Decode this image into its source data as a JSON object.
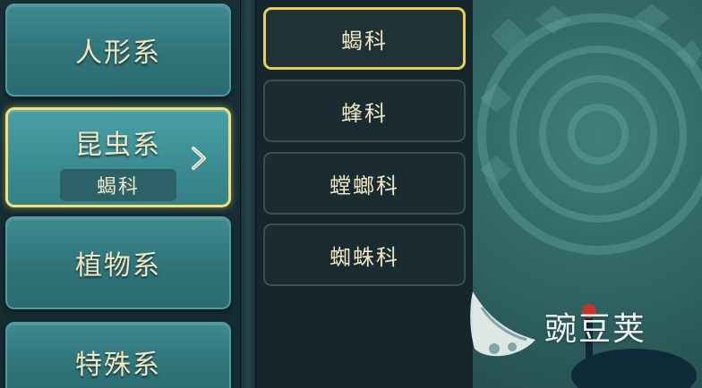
{
  "categories": [
    {
      "label": "人形系"
    },
    {
      "label": "昆虫系",
      "selected_sub": "蝎科"
    },
    {
      "label": "植物系"
    },
    {
      "label": "特殊系"
    }
  ],
  "families": [
    {
      "label": "蝎科"
    },
    {
      "label": "蜂科"
    },
    {
      "label": "螳螂科"
    },
    {
      "label": "蜘蛛科"
    }
  ],
  "watermark": {
    "text": "豌豆荚"
  },
  "colors": {
    "accent_gold": "#f2e07a",
    "category_teal": "#3a8c92",
    "text_cream": "#efe6c4"
  },
  "icons": [
    "chevron-right-icon",
    "watermark-logo-icon"
  ]
}
